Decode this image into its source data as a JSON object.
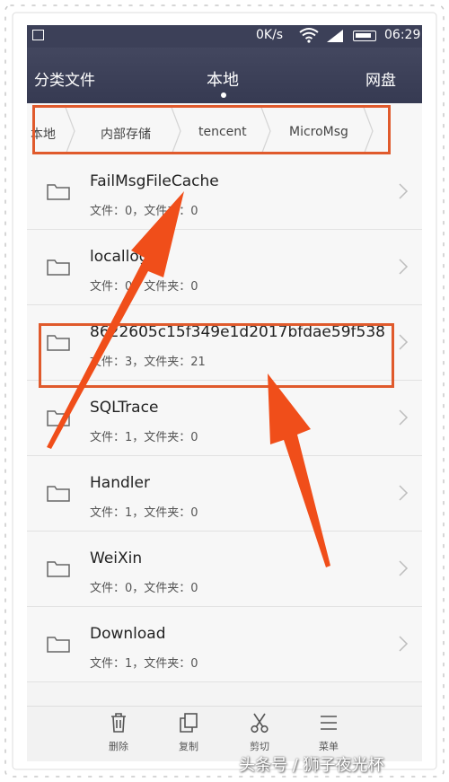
{
  "status": {
    "speed": "0K/s",
    "network": "4G",
    "time": "06:29"
  },
  "tabs": {
    "category": "分类文件",
    "local": "本地",
    "cloud": "网盘"
  },
  "breadcrumb": [
    "本地",
    "内部存储",
    "tencent",
    "MicroMsg"
  ],
  "folders": [
    {
      "name": "FailMsgFileCache",
      "meta": "文件：0，文件夹：0"
    },
    {
      "name": "locallog",
      "meta": "文件：0，文件夹：0"
    },
    {
      "name": "8622605c15f349e1d2017bfdae59f538",
      "meta": "文件：3，文件夹：21"
    },
    {
      "name": "SQLTrace",
      "meta": "文件：1，文件夹：0"
    },
    {
      "name": "Handler",
      "meta": "文件：1，文件夹：0"
    },
    {
      "name": "WeiXin",
      "meta": "文件：0，文件夹：0"
    },
    {
      "name": "Download",
      "meta": "文件：1，文件夹：0"
    }
  ],
  "bottom": {
    "delete": "删除",
    "copy": "复制",
    "cut": "剪切",
    "menu": "菜单"
  },
  "watermark": "头条号 / 狮子夜光杯",
  "colors": {
    "header": "#3c4058",
    "highlight": "#e05a2c",
    "arrow": "#f04e1a"
  }
}
